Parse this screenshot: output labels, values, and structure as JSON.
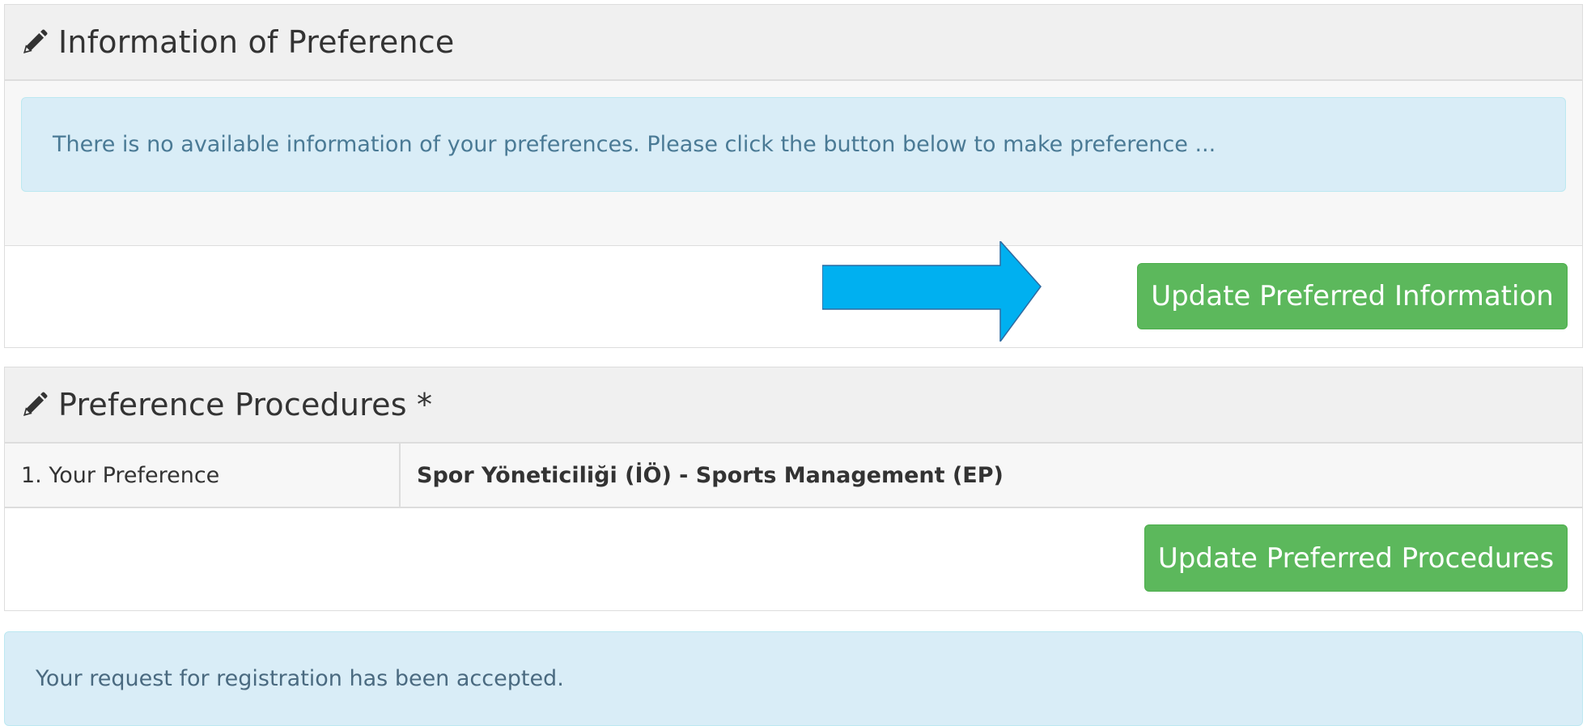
{
  "info_panel": {
    "title": "Information of Preference",
    "alert_text": "There is no available information of your preferences. Please click the button below to make preference ...",
    "button_label": "Update Preferred Information"
  },
  "procedures_panel": {
    "title": "Preference Procedures *",
    "rows": [
      {
        "label": "1. Your Preference",
        "value": "Spor Yöneticiliği (İÖ) - Sports Management (EP)"
      }
    ],
    "button_label": "Update Preferred Procedures"
  },
  "status_alert": {
    "text": "Your request for registration has been accepted."
  },
  "colors": {
    "button_green": "#5cb85c",
    "alert_blue_bg": "#d9edf7",
    "arrow_blue": "#00b0f0"
  },
  "icons": {
    "heading_icon": "pencil-icon",
    "annotation": "right-arrow-icon"
  }
}
